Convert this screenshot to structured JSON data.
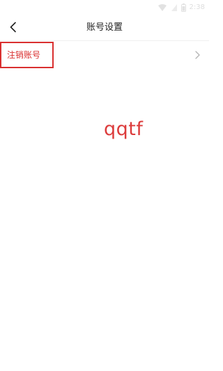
{
  "status_bar": {
    "time": "2:38",
    "icons": [
      "wifi-icon",
      "signal-icon",
      "battery-icon"
    ]
  },
  "header": {
    "title": "账号设置",
    "back_icon": "chevron-left-icon"
  },
  "settings": {
    "items": [
      {
        "label": "注销账号",
        "icon": "chevron-right-icon"
      }
    ]
  },
  "watermark": {
    "text": "qqtf"
  },
  "colors": {
    "accent": "#d92f2f",
    "title_text": "#222222",
    "chevron": "#b3b3b3",
    "background": "#ffffff"
  }
}
